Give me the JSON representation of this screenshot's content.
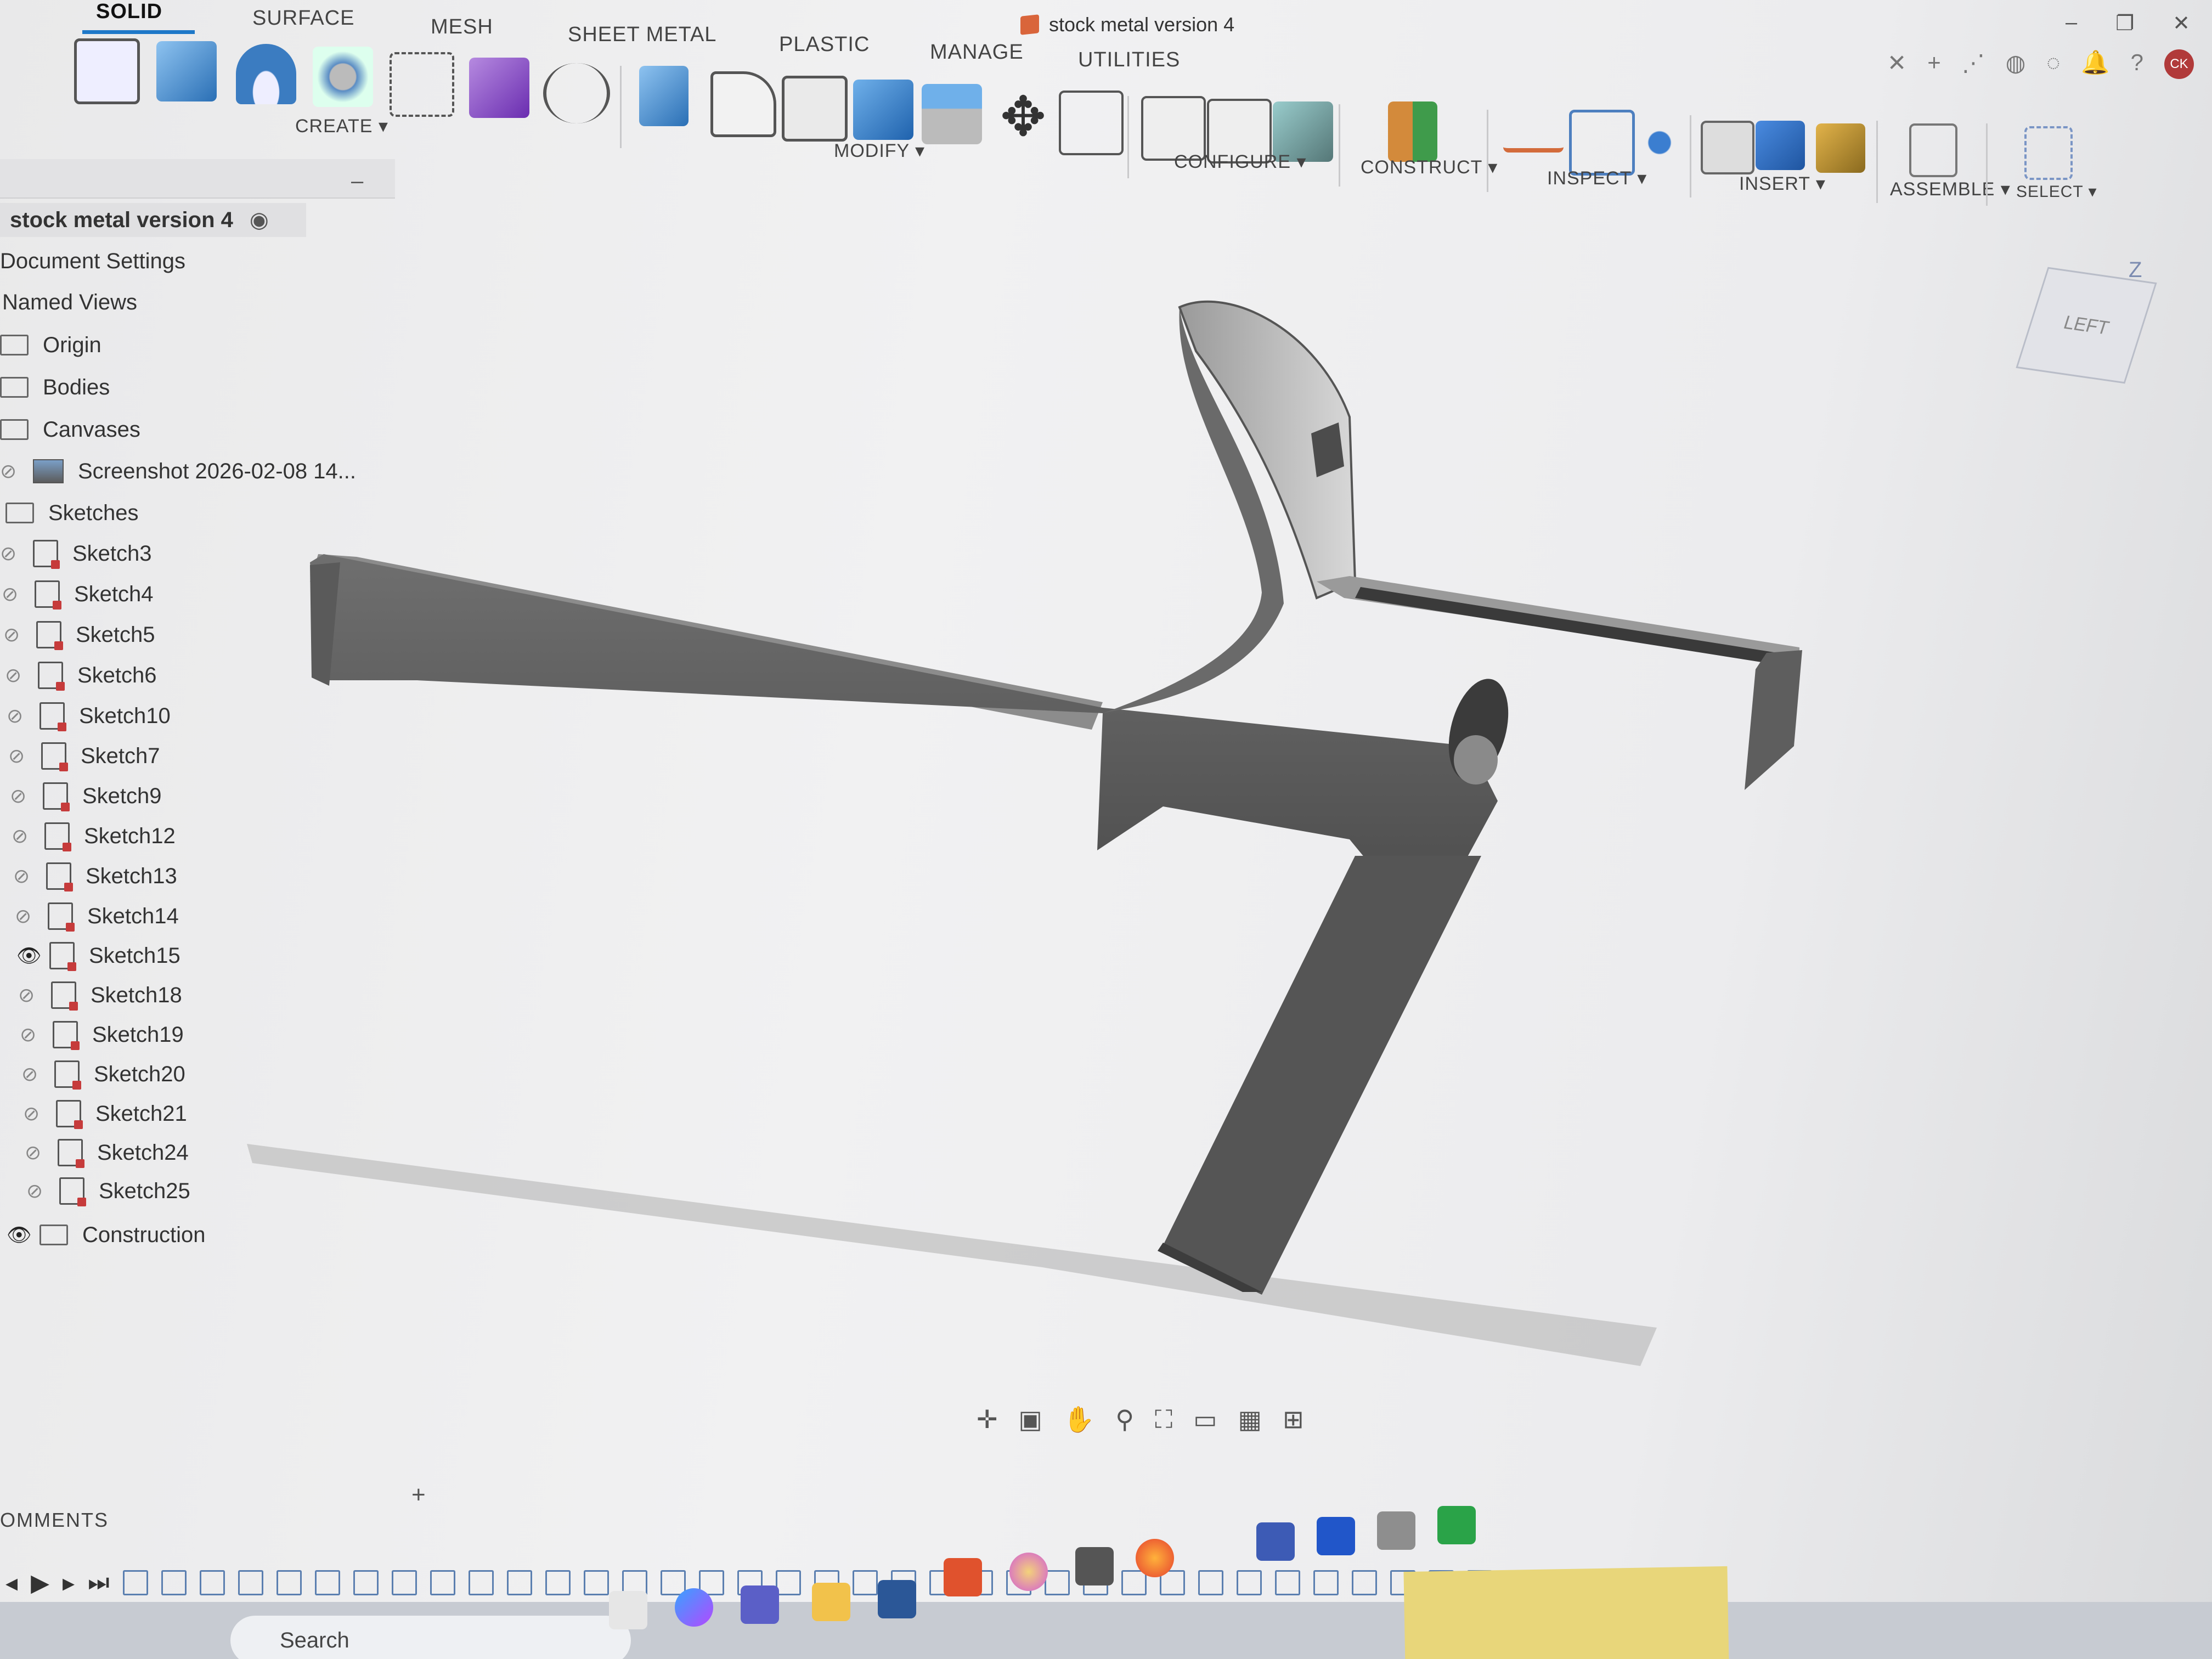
{
  "title": "stock metal version 4",
  "tabs": [
    "SOLID",
    "SURFACE",
    "MESH",
    "SHEET METAL",
    "PLASTIC",
    "MANAGE",
    "UTILITIES"
  ],
  "active_tab": "SOLID",
  "toolbar_groups": [
    "CREATE ▾",
    "MODIFY ▾",
    "CONFIGURE ▾",
    "CONSTRUCT ▾",
    "INSPECT ▾",
    "INSERT ▾",
    "ASSEMBLE ▾",
    "SELECT ▾"
  ],
  "browser": {
    "document": "stock metal version 4",
    "items": [
      "Document Settings",
      "Named Views",
      "Origin",
      "Bodies",
      "Canvases"
    ],
    "canvas_item": "Screenshot 2026-02-08 14...",
    "sketches_folder": "Sketches",
    "sketches": [
      "Sketch3",
      "Sketch4",
      "Sketch5",
      "Sketch6",
      "Sketch10",
      "Sketch7",
      "Sketch9",
      "Sketch12",
      "Sketch13",
      "Sketch14",
      "Sketch15",
      "Sketch18",
      "Sketch19",
      "Sketch20",
      "Sketch21",
      "Sketch24",
      "Sketch25"
    ],
    "visible_sketch": "Sketch15",
    "construction": "Construction"
  },
  "viewcube": {
    "face": "LEFT",
    "axis": "Z"
  },
  "comments_label": "OMMENTS",
  "comments_add": "+",
  "search_placeholder": "Search",
  "colors": {
    "accent": "#1e78c8",
    "body": "#5c5c5c",
    "background": "#eeeeef"
  }
}
